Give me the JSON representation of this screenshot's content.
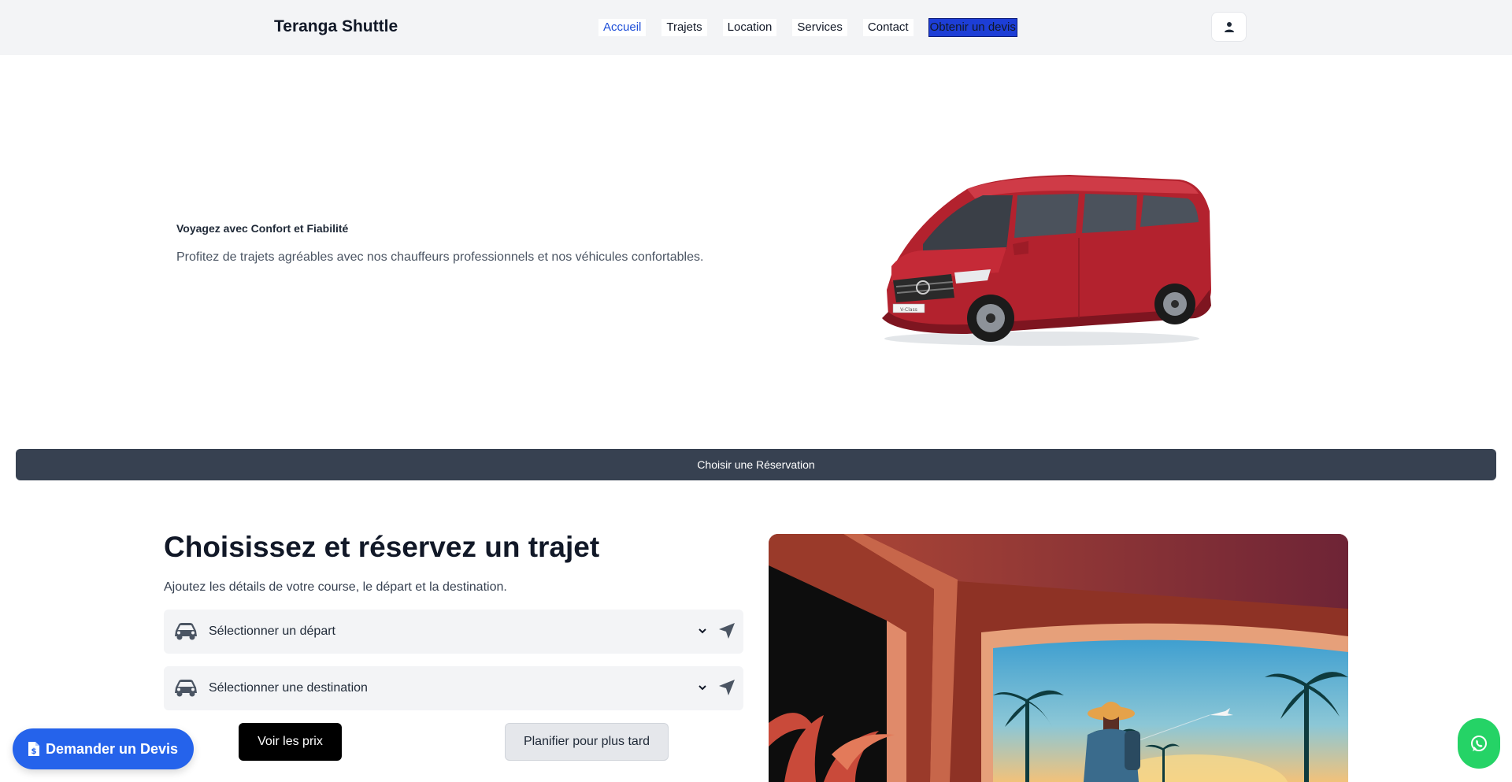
{
  "header": {
    "brand": "Teranga Shuttle",
    "nav": [
      {
        "label": "Accueil",
        "active": true
      },
      {
        "label": "Trajets"
      },
      {
        "label": "Location"
      },
      {
        "label": "Services"
      },
      {
        "label": "Contact"
      },
      {
        "label": "Obtenir un devis"
      }
    ],
    "user_icon": "user-icon"
  },
  "hero": {
    "title": "Voyagez avec Confort et Fiabilité",
    "subtitle": "Profitez de trajets agréables avec nos chauffeurs professionnels et nos véhicules confortables.",
    "image": "red-minivan",
    "plate": "V-Class"
  },
  "reservation_bar": {
    "label": "Choisir une Réservation"
  },
  "booking": {
    "title": "Choisissez et réservez un trajet",
    "subtitle": "Ajoutez les détails de votre course, le départ et la destination.",
    "departure_placeholder": "Sélectionner un départ",
    "destination_placeholder": "Sélectionner une destination",
    "btn_prices": "Voir les prix",
    "btn_later": "Planifier pour plus tard",
    "illustration": "traveler-tropical-window-illustration"
  },
  "floating": {
    "quote_button": "Demander un Devis",
    "whatsapp_icon": "whatsapp-icon"
  },
  "colors": {
    "header_bg": "#f3f4f6",
    "nav_active": "#1d4ed8",
    "cta_bg": "#1d3ed6",
    "bar_bg": "#374151",
    "quote_bg": "#2563eb",
    "whatsapp_bg": "#25d366"
  }
}
